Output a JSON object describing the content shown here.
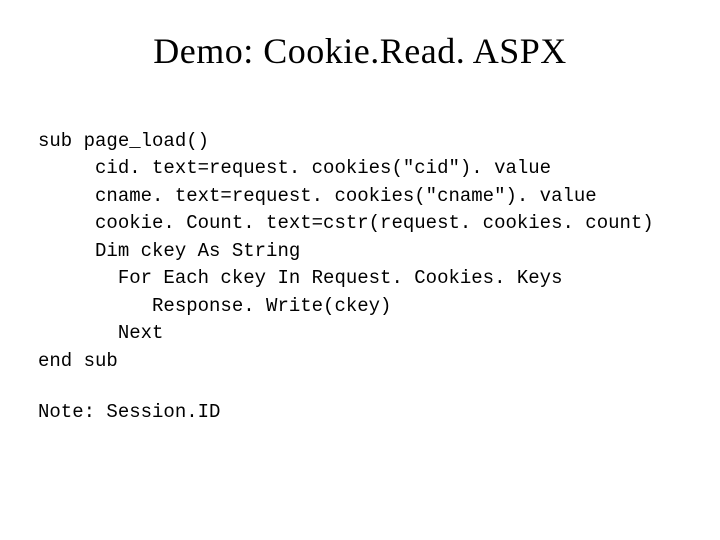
{
  "title": "Demo: Cookie.Read. ASPX",
  "code": {
    "l1": "sub page_load()",
    "l2": "     cid. text=request. cookies(\"cid\"). value",
    "l3": "     cname. text=request. cookies(\"cname\"). value",
    "l4": "     cookie. Count. text=cstr(request. cookies. count)",
    "l5": "     Dim ckey As String",
    "l6": "       For Each ckey In Request. Cookies. Keys",
    "l7": "          Response. Write(ckey)",
    "l8": "       Next",
    "l9": "end sub"
  },
  "note": "Note: Session.ID"
}
